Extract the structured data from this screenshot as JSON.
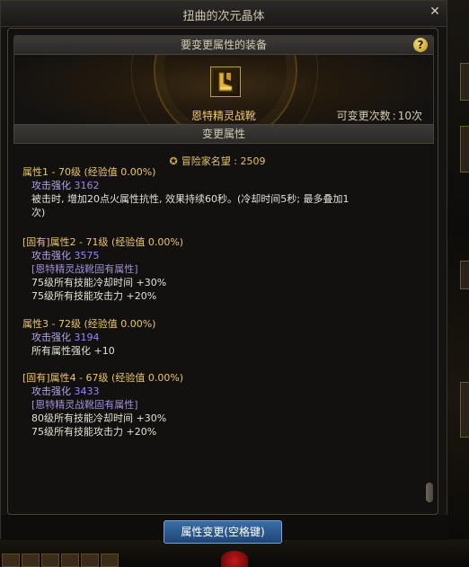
{
  "window": {
    "title": "扭曲的次元晶体",
    "close_symbol": "✕"
  },
  "equip": {
    "header": "要变更属性的装备",
    "help_symbol": "?",
    "item_name": "恩特精灵战靴",
    "change_count_label": "可变更次数",
    "change_count_value": "10次"
  },
  "attr_section": {
    "header": "变更属性",
    "reputation": "冒险家名望 : 2509",
    "blocks": [
      {
        "title": "属性1 - 70级 (经验值 0.00%)",
        "stat_label": "攻击强化",
        "stat_value": "3162",
        "lines": [
          "被击时, 增加20点火属性抗性, 效果持续60秒。(冷却时间5秒; 最多叠加1",
          "次)"
        ]
      },
      {
        "title": "[固有]属性2 - 71级 (经验值 0.00%)",
        "stat_label": "攻击强化",
        "stat_value": "3575",
        "fixed_tag": "[恩特精灵战靴固有属性]",
        "lines": [
          "75级所有技能冷却时间 +30%",
          "75级所有技能攻击力 +20%"
        ]
      },
      {
        "title": "属性3 - 72级 (经验值 0.00%)",
        "stat_label": "攻击强化",
        "stat_value": "3194",
        "lines": [
          "所有属性强化 +10"
        ]
      },
      {
        "title": "[固有]属性4 - 67级 (经验值 0.00%)",
        "stat_label": "攻击强化",
        "stat_value": "3433",
        "fixed_tag": "[恩特精灵战靴固有属性]",
        "lines": [
          "80级所有技能冷却时间 +30%",
          "75级所有技能攻击力 +20%"
        ]
      }
    ]
  },
  "action_button": "属性变更(空格键)",
  "colors": {
    "gold": "#e8c66a",
    "purple": "#9a86ff",
    "button_blue": "#2f5f98"
  },
  "icons": {
    "item": "boots-icon",
    "reputation": "reputation-icon",
    "help": "help-icon",
    "close": "close-icon"
  }
}
